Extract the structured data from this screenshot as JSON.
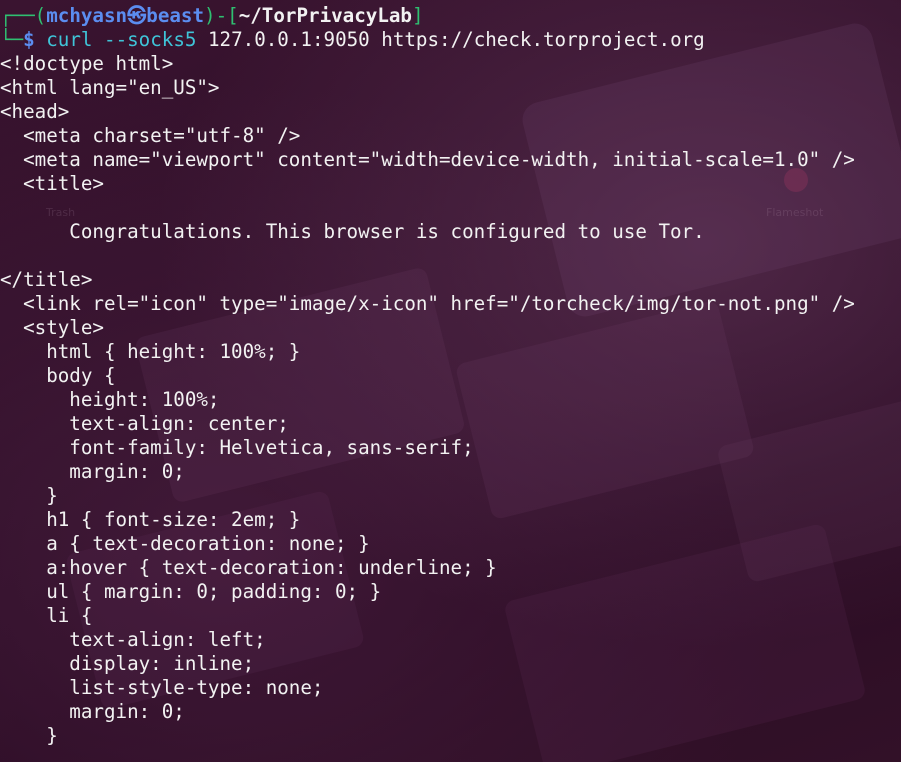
{
  "prompt": {
    "corner_top": "┌──(",
    "user": "mchyasn",
    "kali_icon": "㉿",
    "host": "beast",
    "bracket_close": ")-[",
    "cwd": "~/TorPrivacyLab",
    "cwd_close": "]",
    "corner_bottom": "└─",
    "symbol": "$"
  },
  "command": {
    "program": "curl",
    "option": "--socks5",
    "args": "127.0.0.1:9050 https://check.torproject.org"
  },
  "output_lines": [
    "<!doctype html>",
    "<html lang=\"en_US\">",
    "<head>",
    "  <meta charset=\"utf-8\" />",
    "  <meta name=\"viewport\" content=\"width=device-width, initial-scale=1.0\" />",
    "  <title>",
    "",
    "      Congratulations. This browser is configured to use Tor.",
    "",
    "</title>",
    "  <link rel=\"icon\" type=\"image/x-icon\" href=\"/torcheck/img/tor-not.png\" />",
    "  <style>",
    "    html { height: 100%; }",
    "    body {",
    "      height: 100%;",
    "      text-align: center;",
    "      font-family: Helvetica, sans-serif;",
    "      margin: 0;",
    "    }",
    "    h1 { font-size: 2em; }",
    "    a { text-decoration: none; }",
    "    a:hover { text-decoration: underline; }",
    "    ul { margin: 0; padding: 0; }",
    "    li {",
    "      text-align: left;",
    "      display: inline;",
    "      list-style-type: none;",
    "      margin: 0;",
    "    }"
  ],
  "desktop": {
    "trash_label": "Trash",
    "flameshot_label": "Flameshot"
  },
  "colors": {
    "prompt_green": "#2fbf71",
    "prompt_blue": "#5b8df0",
    "command_cyan": "#3fc4d8",
    "text": "#f2f2f2",
    "background": "#2c0c24"
  }
}
